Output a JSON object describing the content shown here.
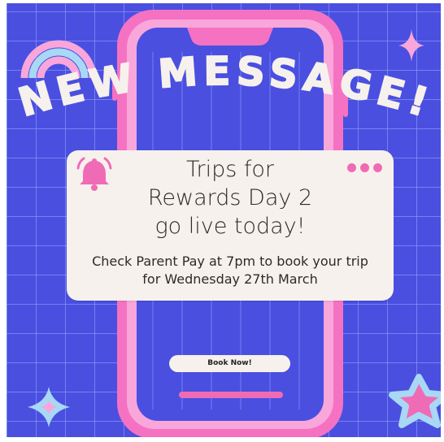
{
  "headline": "NEW MESSAGE!",
  "card": {
    "title_lines": [
      "Trips for",
      "Rewards Day 2",
      "go live today!"
    ],
    "body_lines": [
      "Check Parent Pay at 7pm to book your trip",
      "for Wednesday 27th March"
    ]
  },
  "button": {
    "label": "Book Now!"
  },
  "icons": {
    "bell": "bell-icon",
    "dots": "more-dots-icon",
    "rainbow": "rainbow-icon",
    "sparkle": "sparkle-icon",
    "star": "star-icon"
  },
  "colors": {
    "background": "#4a4fe0",
    "grid": "#96aaff",
    "phone_outer": "#f572c2",
    "phone_inner": "#f9a6db",
    "accent_pink": "#f06bb5",
    "card": "#f6f1ec",
    "headline": "#f6f1ec",
    "light_blue": "#a8d8f5"
  }
}
